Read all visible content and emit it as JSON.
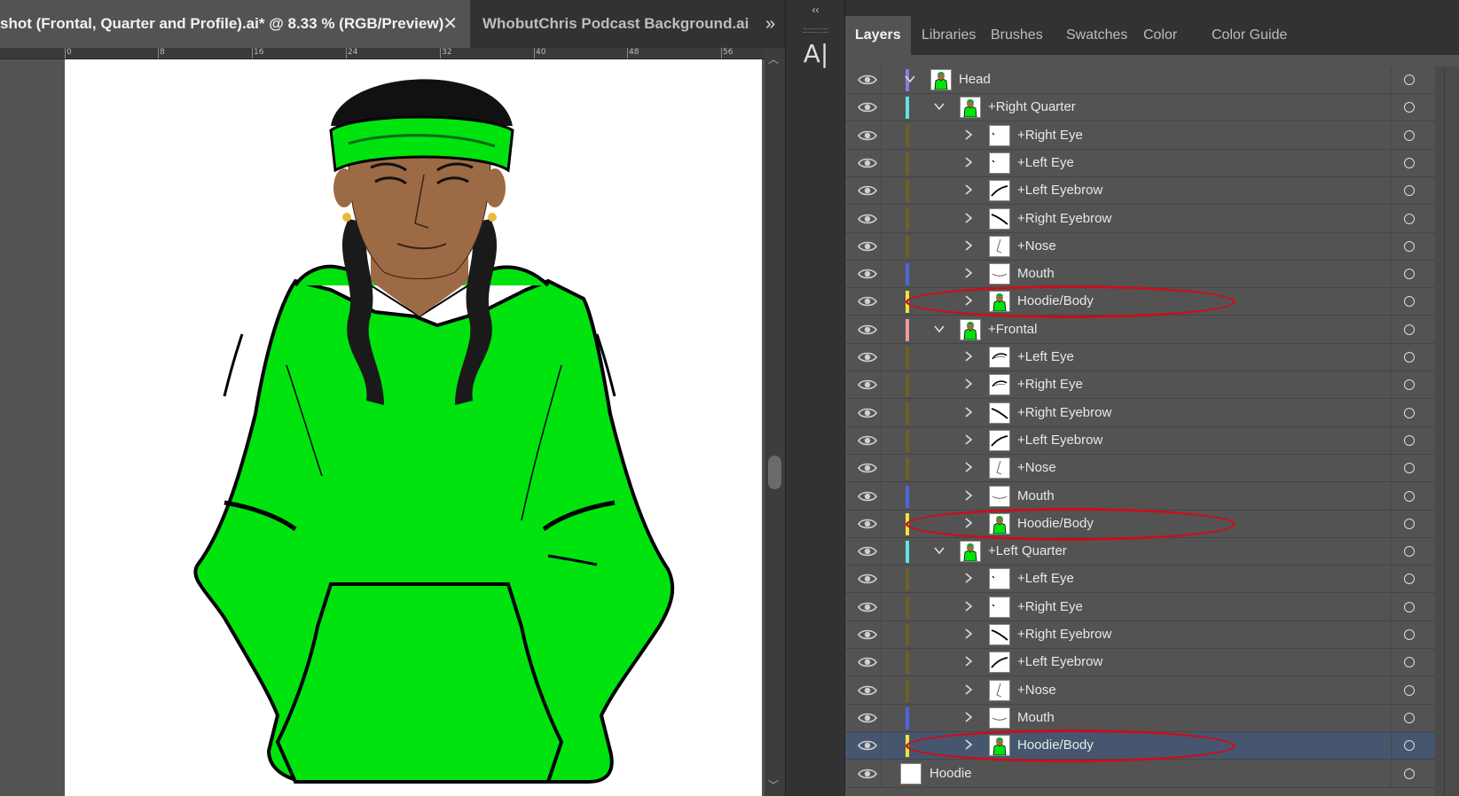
{
  "document": {
    "active_tab_title": "shot (Frontal, Quarter and Profile).ai* @ 8.33 % (RGB/Preview)",
    "inactive_tab_title": "WhobutChris Podcast Background.ai",
    "ruler_labels": [
      "0",
      "8",
      "16",
      "24",
      "32",
      "40",
      "48",
      "56"
    ]
  },
  "panel": {
    "tabs": [
      "Layers",
      "Libraries",
      "Brushes",
      "Swatches",
      "Color",
      "Color Guide"
    ],
    "active_tab": "Layers"
  },
  "layers": [
    {
      "name": "Head",
      "indent": 0,
      "expanded": true,
      "color": "#8a7be0",
      "thumb": "figure"
    },
    {
      "name": "+Right Quarter",
      "indent": 1,
      "expanded": true,
      "color": "#5ee3e6",
      "thumb": "figure"
    },
    {
      "name": "+Right Eye",
      "indent": 2,
      "expanded": false,
      "color": "#6b6221",
      "thumb": "eye-mark"
    },
    {
      "name": "+Left Eye",
      "indent": 2,
      "expanded": false,
      "color": "#6b6221",
      "thumb": "eye-mark"
    },
    {
      "name": "+Left Eyebrow",
      "indent": 2,
      "expanded": false,
      "color": "#6b6221",
      "thumb": "brow"
    },
    {
      "name": "+Right Eyebrow",
      "indent": 2,
      "expanded": false,
      "color": "#6b6221",
      "thumb": "brow-r"
    },
    {
      "name": "+Nose",
      "indent": 2,
      "expanded": false,
      "color": "#6b6221",
      "thumb": "nose"
    },
    {
      "name": "Mouth",
      "indent": 2,
      "expanded": false,
      "color": "#4a66e0",
      "thumb": "mouth"
    },
    {
      "name": "Hoodie/Body",
      "indent": 2,
      "expanded": false,
      "color": "#f4e23a",
      "thumb": "figure",
      "highlighted": true
    },
    {
      "name": "+Frontal",
      "indent": 1,
      "expanded": true,
      "color": "#f29a9a",
      "thumb": "figure"
    },
    {
      "name": "+Left Eye",
      "indent": 2,
      "expanded": false,
      "color": "#6b6221",
      "thumb": "eye-full"
    },
    {
      "name": "+Right Eye",
      "indent": 2,
      "expanded": false,
      "color": "#6b6221",
      "thumb": "eye-full"
    },
    {
      "name": "+Right Eyebrow",
      "indent": 2,
      "expanded": false,
      "color": "#6b6221",
      "thumb": "brow-r"
    },
    {
      "name": "+Left Eyebrow",
      "indent": 2,
      "expanded": false,
      "color": "#6b6221",
      "thumb": "brow"
    },
    {
      "name": "+Nose",
      "indent": 2,
      "expanded": false,
      "color": "#6b6221",
      "thumb": "nose"
    },
    {
      "name": "Mouth",
      "indent": 2,
      "expanded": false,
      "color": "#4a66e0",
      "thumb": "mouth"
    },
    {
      "name": "Hoodie/Body",
      "indent": 2,
      "expanded": false,
      "color": "#f4e23a",
      "thumb": "figure",
      "highlighted": true
    },
    {
      "name": "+Left Quarter",
      "indent": 1,
      "expanded": true,
      "color": "#5ee3e6",
      "thumb": "figure"
    },
    {
      "name": "+Left Eye",
      "indent": 2,
      "expanded": false,
      "color": "#6b6221",
      "thumb": "eye-mark"
    },
    {
      "name": "+Right Eye",
      "indent": 2,
      "expanded": false,
      "color": "#6b6221",
      "thumb": "eye-mark"
    },
    {
      "name": "+Right Eyebrow",
      "indent": 2,
      "expanded": false,
      "color": "#6b6221",
      "thumb": "brow-r"
    },
    {
      "name": "+Left Eyebrow",
      "indent": 2,
      "expanded": false,
      "color": "#6b6221",
      "thumb": "brow"
    },
    {
      "name": "+Nose",
      "indent": 2,
      "expanded": false,
      "color": "#6b6221",
      "thumb": "nose"
    },
    {
      "name": "Mouth",
      "indent": 2,
      "expanded": false,
      "color": "#4a66e0",
      "thumb": "mouth"
    },
    {
      "name": "Hoodie/Body",
      "indent": 2,
      "expanded": false,
      "color": "#f4e23a",
      "thumb": "figure",
      "highlighted": true,
      "selected": true
    },
    {
      "name": "Hoodie",
      "indent": -1,
      "expanded": false,
      "color": "#b81818",
      "thumb": "blank"
    }
  ],
  "colors": {
    "hoodie_green": "#00e30f",
    "skin": "#9c6a45",
    "hair": "#1a1a1a",
    "annotation_red": "#c8101c",
    "selected_row": "#46566f"
  }
}
